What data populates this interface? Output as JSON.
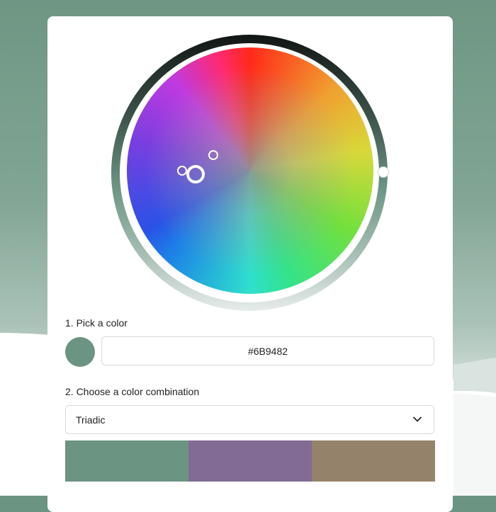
{
  "background": {
    "color": "#6B9482"
  },
  "wheel": {
    "selected_color": "#6B9482",
    "handles": [
      "primary-handle",
      "secondary-handle",
      "tertiary-handle"
    ]
  },
  "step1": {
    "label": "1. Pick a color",
    "swatch_color": "#6B9482",
    "hex_value": "#6B9482"
  },
  "step2": {
    "label": "2. Choose a color combination",
    "selected_combination": "Triadic",
    "chevron_icon": "chevron-down-icon"
  },
  "palette": {
    "colors": [
      "#6B9482",
      "#826B94",
      "#94826B"
    ]
  }
}
